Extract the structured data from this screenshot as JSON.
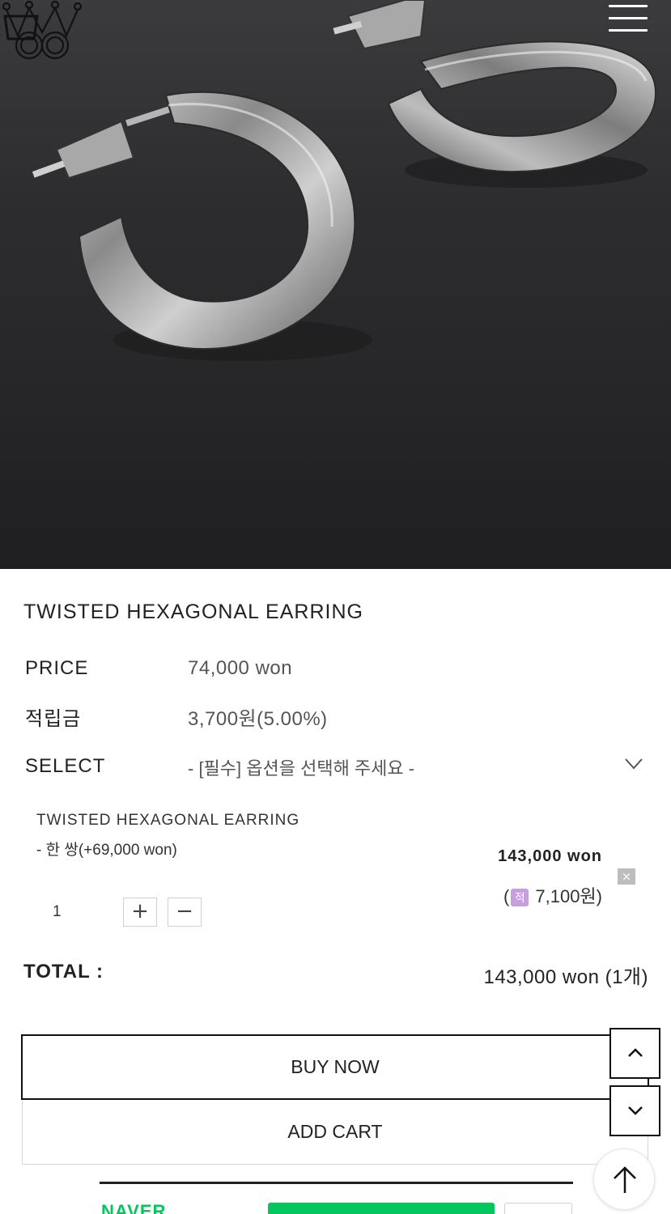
{
  "header": {
    "logo_icon": "crown-logo-icon",
    "cart_icon": "shopping-bag-icon",
    "menu_icon": "hamburger-menu-icon"
  },
  "hero": {
    "image_icon": "silver-hoop-earrings-photo"
  },
  "product": {
    "title": "TWISTED HEXAGONAL EARRING",
    "price_label": "PRICE",
    "price_value": "74,000 won",
    "points_label": "적립금",
    "points_value": "3,700원(5.00%)",
    "select_label": "SELECT",
    "select_placeholder": "- [필수] 옵션을 선택해 주세요 -"
  },
  "selected_option": {
    "name": "TWISTED HEXAGONAL EARRING",
    "detail": "- 한 쌍(+69,000 won)",
    "price": "143,000 won",
    "points_open": "(",
    "points_badge": "적",
    "points_amount": " 7,100원)",
    "remove": "×",
    "quantity": "1",
    "plus": "+",
    "minus": "−"
  },
  "total": {
    "label": "TOTAL :",
    "value": "143,000 won (1개)"
  },
  "actions": {
    "buy_now": "BUY NOW",
    "add_cart": "ADD CART"
  },
  "naver": {
    "logo_text": "NAVER"
  },
  "colors": {
    "naver_green": "#03c75a",
    "points_badge": "#c89ee0"
  }
}
